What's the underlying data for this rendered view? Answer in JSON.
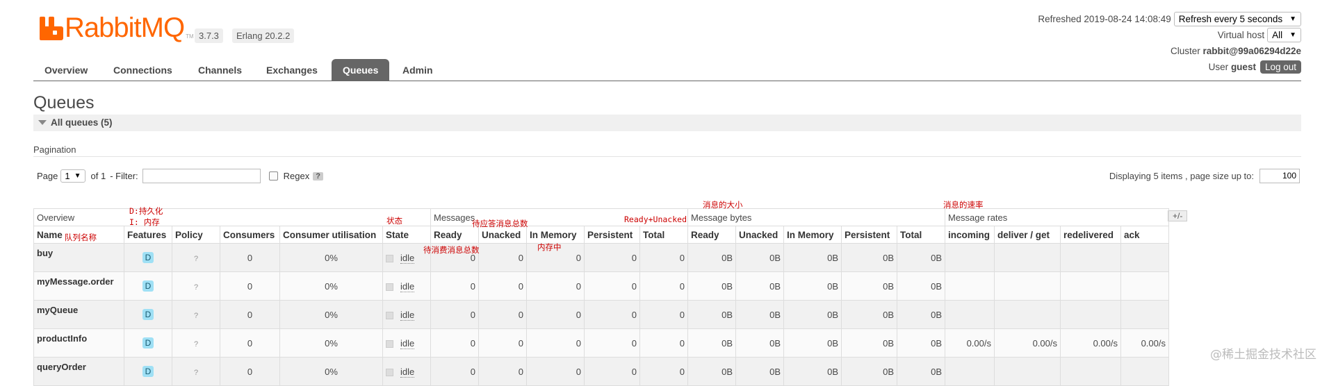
{
  "app": {
    "logo_text": "RabbitMQ",
    "logo_tm": "TM",
    "version": "3.7.3",
    "erlang": "Erlang 20.2.2",
    "refreshed": "Refreshed 2019-08-24 14:08:49",
    "refresh_option": "Refresh every 5 seconds",
    "virtual_host_label": "Virtual host",
    "virtual_host_value": "All",
    "cluster_label": "Cluster",
    "cluster_value": "rabbit@99a06294d22e",
    "user_label": "User",
    "user_value": "guest",
    "logout_label": "Log out"
  },
  "tabs": [
    {
      "label": "Overview"
    },
    {
      "label": "Connections"
    },
    {
      "label": "Channels"
    },
    {
      "label": "Exchanges"
    },
    {
      "label": "Queues",
      "active": true
    },
    {
      "label": "Admin"
    }
  ],
  "page": {
    "title": "Queues",
    "section": "All queues (5)",
    "pagination_label": "Pagination",
    "page_label": "Page",
    "page_value": "1",
    "of_label": "of 1",
    "filter_label": "- Filter:",
    "filter_value": "",
    "regex_label": "Regex",
    "help_label": "?",
    "display_text": "Displaying 5 items , page size up to:",
    "page_size": "100",
    "plusminus": "+/-"
  },
  "table": {
    "groups": [
      "Overview",
      "Messages",
      "Message bytes",
      "Message rates"
    ],
    "headers": [
      "Name",
      "Features",
      "Policy",
      "Consumers",
      "Consumer utilisation",
      "State",
      "Ready",
      "Unacked",
      "In Memory",
      "Persistent",
      "Total",
      "Ready",
      "Unacked",
      "In Memory",
      "Persistent",
      "Total",
      "incoming",
      "deliver / get",
      "redelivered",
      "ack"
    ],
    "rows": [
      {
        "name": "buy",
        "feature": "D",
        "policy": "?",
        "consumers": "0",
        "util": "0%",
        "state": "idle",
        "m_ready": "0",
        "m_unacked": "0",
        "m_mem": "0",
        "m_persist": "0",
        "m_total": "0",
        "b_ready": "0B",
        "b_unacked": "0B",
        "b_mem": "0B",
        "b_persist": "0B",
        "b_total": "0B",
        "r_in": "",
        "r_deliver": "",
        "r_redeliv": "",
        "r_ack": ""
      },
      {
        "name": "myMessage.order",
        "feature": "D",
        "policy": "?",
        "consumers": "0",
        "util": "0%",
        "state": "idle",
        "m_ready": "0",
        "m_unacked": "0",
        "m_mem": "0",
        "m_persist": "0",
        "m_total": "0",
        "b_ready": "0B",
        "b_unacked": "0B",
        "b_mem": "0B",
        "b_persist": "0B",
        "b_total": "0B",
        "r_in": "",
        "r_deliver": "",
        "r_redeliv": "",
        "r_ack": ""
      },
      {
        "name": "myQueue",
        "feature": "D",
        "policy": "?",
        "consumers": "0",
        "util": "0%",
        "state": "idle",
        "m_ready": "0",
        "m_unacked": "0",
        "m_mem": "0",
        "m_persist": "0",
        "m_total": "0",
        "b_ready": "0B",
        "b_unacked": "0B",
        "b_mem": "0B",
        "b_persist": "0B",
        "b_total": "0B",
        "r_in": "",
        "r_deliver": "",
        "r_redeliv": "",
        "r_ack": ""
      },
      {
        "name": "productInfo",
        "feature": "D",
        "policy": "?",
        "consumers": "0",
        "util": "0%",
        "state": "idle",
        "m_ready": "0",
        "m_unacked": "0",
        "m_mem": "0",
        "m_persist": "0",
        "m_total": "0",
        "b_ready": "0B",
        "b_unacked": "0B",
        "b_mem": "0B",
        "b_persist": "0B",
        "b_total": "0B",
        "r_in": "0.00/s",
        "r_deliver": "0.00/s",
        "r_redeliv": "0.00/s",
        "r_ack": "0.00/s"
      },
      {
        "name": "queryOrder",
        "feature": "D",
        "policy": "?",
        "consumers": "0",
        "util": "0%",
        "state": "idle",
        "m_ready": "0",
        "m_unacked": "0",
        "m_mem": "0",
        "m_persist": "0",
        "m_total": "0",
        "b_ready": "0B",
        "b_unacked": "0B",
        "b_mem": "0B",
        "b_persist": "0B",
        "b_total": "0B",
        "r_in": "",
        "r_deliver": "",
        "r_redeliv": "",
        "r_ack": ""
      }
    ]
  },
  "annotations": {
    "durable": "D:持久化",
    "inmem": "I: 内存",
    "state": "状态",
    "unacked_total": "待应答消息总数",
    "ready_unacked": "Ready+Unacked",
    "msg_size": "消息的大小",
    "msg_rate": "消息的速率",
    "queue_name": "队列名称",
    "ready_total": "待消费消息总数",
    "in_memory": "内存中"
  },
  "watermark": "@稀土掘金技术社区"
}
